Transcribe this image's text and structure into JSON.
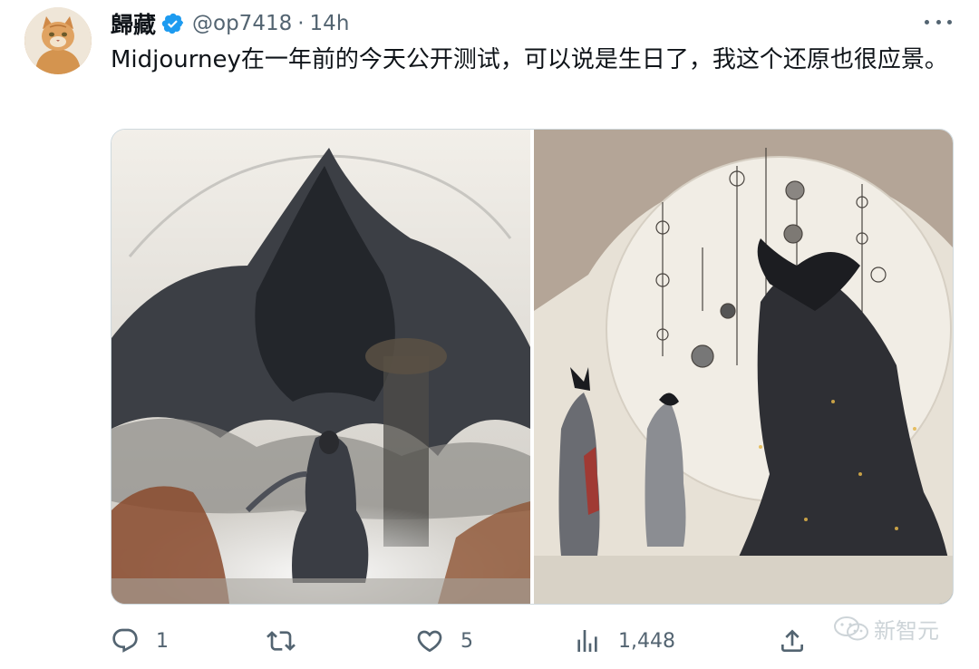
{
  "tweet": {
    "author": {
      "display_name": "歸藏",
      "handle": "@op7418",
      "verified": true,
      "avatar_icon": "cat-avatar"
    },
    "separator": "·",
    "time": "14h",
    "text": "Midjourney在一年前的今天公开测试，可以说是生日了，我这个还原也很应景。",
    "media": [
      {
        "icon": "artwork-image-wanderer"
      },
      {
        "icon": "artwork-image-moon-figures"
      }
    ],
    "actions": {
      "reply_count": "1",
      "retweet_count": "",
      "like_count": "5",
      "views_count": "1,448",
      "share_count": ""
    }
  },
  "watermark": {
    "text": "新智元",
    "icon": "wechat-icon"
  },
  "colors": {
    "text_primary": "#0f1419",
    "text_secondary": "#536471",
    "verified_blue": "#1d9bf0",
    "border": "#cfd9de"
  }
}
